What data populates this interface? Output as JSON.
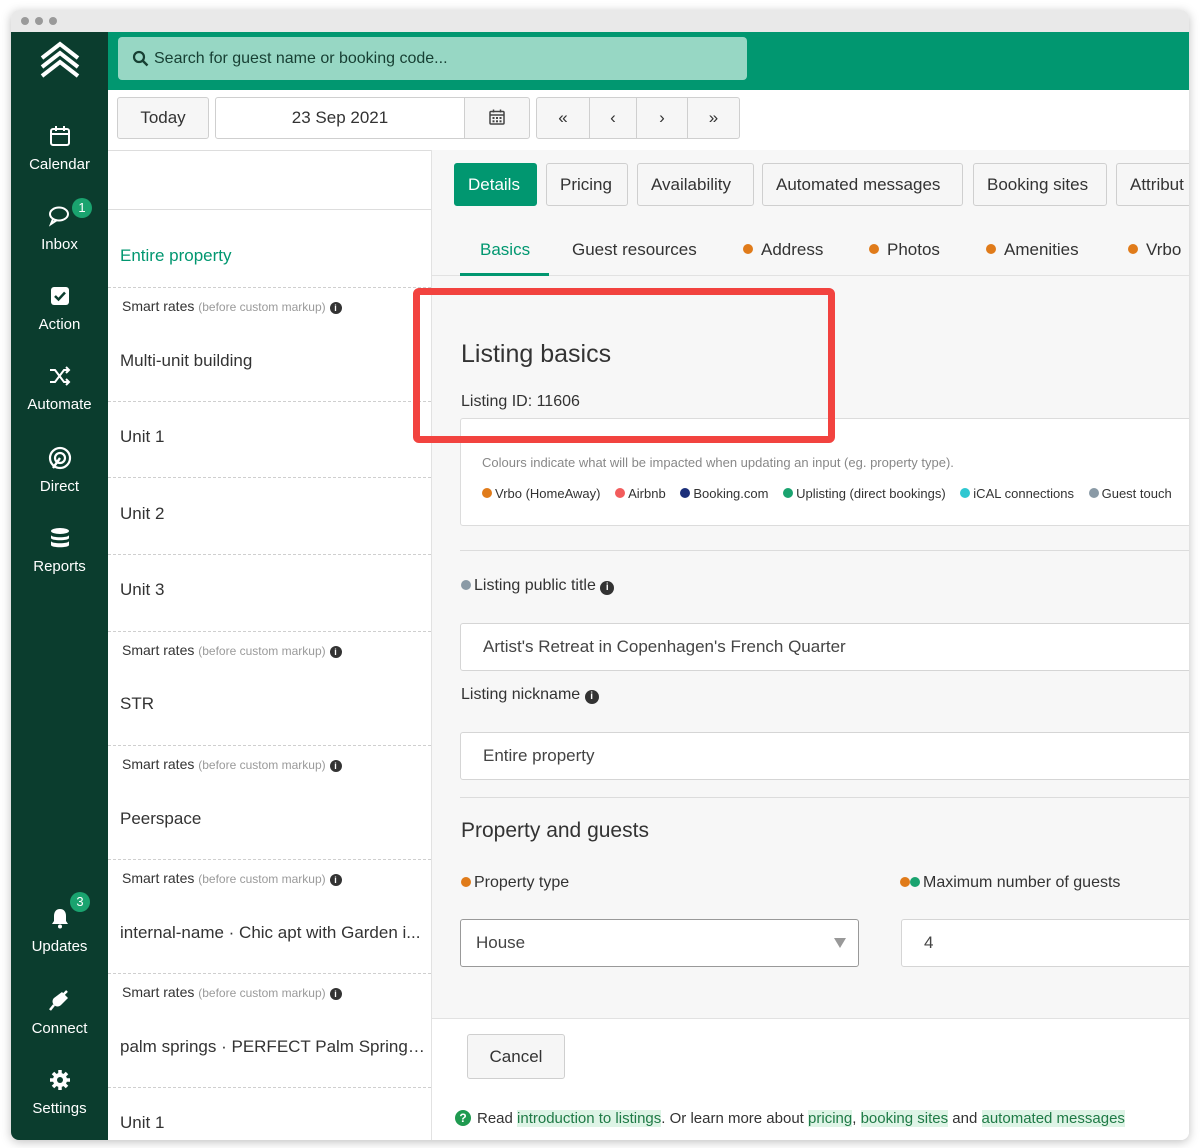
{
  "sidebar": {
    "items": [
      {
        "label": "Calendar",
        "icon": "calendar-icon"
      },
      {
        "label": "Inbox",
        "icon": "chat-icon",
        "badge": "1"
      },
      {
        "label": "Action",
        "icon": "checkbox-icon"
      },
      {
        "label": "Automate",
        "icon": "shuffle-icon"
      },
      {
        "label": "Direct",
        "icon": "target-icon"
      },
      {
        "label": "Reports",
        "icon": "database-icon"
      },
      {
        "label": "Updates",
        "icon": "bell-icon",
        "badge": "3"
      },
      {
        "label": "Connect",
        "icon": "plug-icon"
      },
      {
        "label": "Settings",
        "icon": "gear-icon"
      }
    ]
  },
  "search": {
    "placeholder": "Search for guest name or booking code..."
  },
  "toolbar": {
    "today_label": "Today",
    "date_value": "23 Sep 2021",
    "first_label": "«",
    "prev_label": "‹",
    "next_label": "›",
    "last_label": "»"
  },
  "listing_column": {
    "entire_property": "Entire property",
    "smart_rates_label": "Smart rates",
    "smart_rates_note": "(before custom markup)",
    "rows": [
      "Multi-unit building",
      "Unit 1",
      "Unit 2",
      "Unit 3",
      "STR",
      "Peerspace",
      "internal-name · Chic apt with Garden i...",
      "palm springs · PERFECT Palm Springs ...",
      "Unit 1"
    ]
  },
  "tabs": [
    "Details",
    "Pricing",
    "Availability",
    "Automated messages",
    "Booking sites",
    "Attribut"
  ],
  "subtabs": [
    "Basics",
    "Guest resources",
    "Address",
    "Photos",
    "Amenities",
    "Vrbo"
  ],
  "listing": {
    "heading": "Listing basics",
    "id_text": "Listing ID: 11606",
    "legend_note": "Colours indicate what will be impacted when updating an input (eg. property type).",
    "legend": [
      {
        "label": "Vrbo (HomeAway)",
        "color": "#e07b1a"
      },
      {
        "label": "Airbnb",
        "color": "#f25c5c"
      },
      {
        "label": "Booking.com",
        "color": "#1b2f7a"
      },
      {
        "label": "Uplisting (direct bookings)",
        "color": "#1aa36f"
      },
      {
        "label": "iCAL connections",
        "color": "#2ec7d1"
      },
      {
        "label": "Guest touch",
        "color": "#8a9aa6"
      }
    ],
    "public_title_label": "Listing public title",
    "public_title_value": "Artist's Retreat in Copenhagen's French Quarter",
    "nickname_label": "Listing nickname",
    "nickname_value": "Entire property"
  },
  "property": {
    "heading": "Property and guests",
    "type_label": "Property type",
    "type_value": "House",
    "max_guests_label": "Maximum number of guests",
    "max_guests_value": "4"
  },
  "footer": {
    "cancel_label": "Cancel",
    "help_prefix": "Read",
    "link_intro": "introduction to listings",
    "help_mid": ". Or learn more about",
    "link_pricing": "pricing",
    "link_booking": "booking sites",
    "help_and": "and",
    "link_automated": "automated messages"
  },
  "colors": {
    "brand": "#019770",
    "sidebar": "#0b3d2e",
    "highlight": "#f2433f"
  }
}
